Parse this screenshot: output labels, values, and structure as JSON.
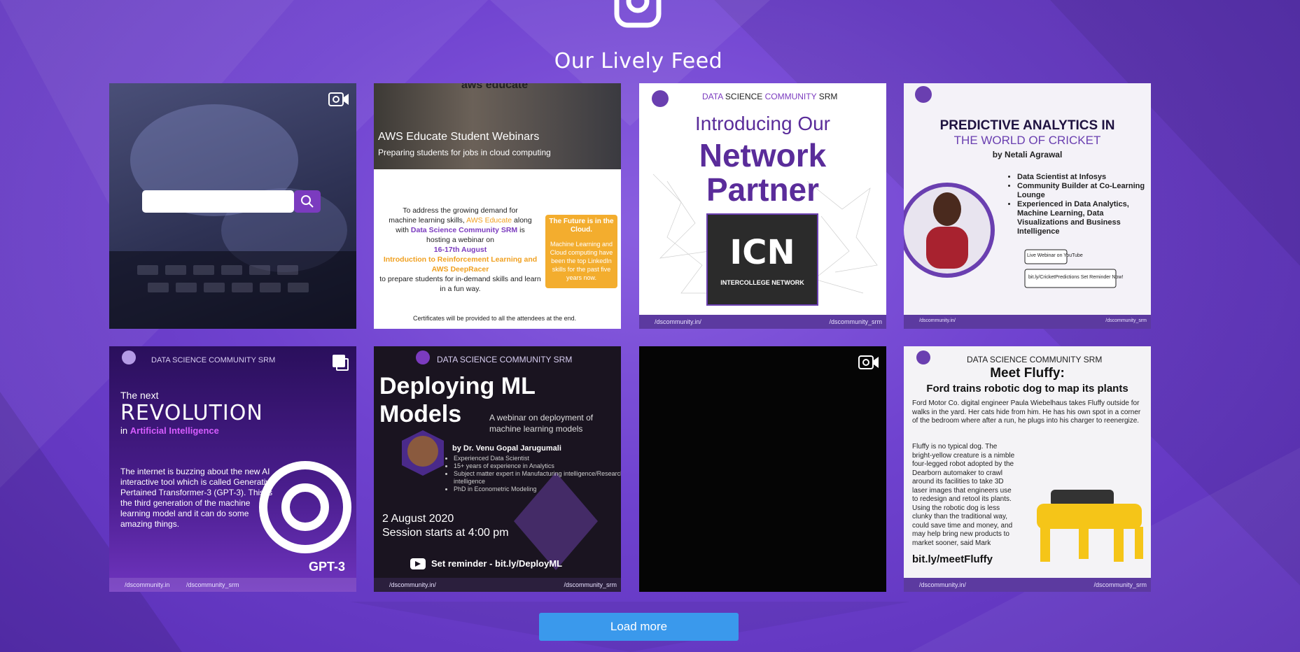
{
  "feed": {
    "title": "Our Lively Feed",
    "load_more_label": "Load more",
    "accent_button": "#3a99ec",
    "tiles": [
      {
        "kind": "video",
        "caption": ""
      },
      {
        "kind": "image",
        "top_logo": "aws educate",
        "heading": "AWS Educate Student Webinars",
        "subheading": "Preparing students for jobs in cloud computing",
        "body_lines": [
          "To address the growing demand for",
          "machine learning skills,",
          "with",
          "is",
          "hosting a webinar on"
        ],
        "highlight_aws": "AWS Educate",
        "along": "along",
        "highlight_dsc": "Data Science Community SRM",
        "date": "16-17th August",
        "topic": "Introduction to Reinforcement Learning and AWS DeepRacer",
        "tail": "to prepare students for in-demand skills and learn in a fun way.",
        "side_title": "The Future is in the Cloud.",
        "side_body": "Machine Learning and Cloud computing have been the top LinkedIn skills for the past five years now.",
        "certificates": "Certificates will be provided to all the attendees at the end."
      },
      {
        "kind": "image",
        "brand_a": "DATA",
        "brand_b": "SCIENCE",
        "brand_c": "COMMUNITY",
        "brand_d": "SRM",
        "line1": "Introducing Our",
        "line2": "Network",
        "line3": "Partner",
        "logo_text": "ICN",
        "logo_sub": "INTERCOLLEGE NETWORK",
        "footer_left": "/dscommunity.in/",
        "footer_right": "/dscommunity_srm"
      },
      {
        "kind": "image",
        "title1": "PREDICTIVE ANALYTICS IN",
        "title2": "THE WORLD OF CRICKET",
        "by": "by Netali Agrawal",
        "bullets": [
          "Data Scientist at Infosys",
          "Community Builder at Co-Learning Lounge",
          "Experienced in Data Analytics, Machine Learning, Data Visualizations and Business Intelligence"
        ],
        "cta1": "Live Webinar on YouTube",
        "cta2": "bit.ly/CricketPredictions Set Reminder Now!",
        "footer_left": "/dscommunity.in/",
        "footer_right": "/dscommunity_srm"
      },
      {
        "kind": "carousel",
        "next": "The next",
        "revolution": "REVOLUTION",
        "in_ai_prefix": "in",
        "in_ai": "Artificial Intelligence",
        "body": "The internet is buzzing about the new AI interactive tool which is called Generative Pertained Transformer-3 (GPT-3). This is the third generation of the machine learning model and it can do some amazing things.",
        "gpt": "GPT-3",
        "footer_left": "/dscommunity.in",
        "footer_right": "/dscommunity_srm"
      },
      {
        "kind": "image",
        "title1": "Deploying ML",
        "title2": "Models",
        "tag1": "A webinar on deployment of",
        "tag2": "machine learning models",
        "by": "by Dr. Venu Gopal Jarugumali",
        "bullets": [
          "Experienced Data Scientist",
          "15+ years of experience in Analytics",
          "Subject matter expert in Manufacturing intelligence/Research intelligence",
          "PhD in Econometric Modeling"
        ],
        "date": "2 August 2020",
        "time": "Session starts at 4:00 pm",
        "cta": "Set reminder - bit.ly/DeployML",
        "footer_left": "/dscommunity.in/",
        "footer_right": "/dscommunity_srm"
      },
      {
        "kind": "video",
        "caption": ""
      },
      {
        "kind": "image",
        "title": "Meet Fluffy:",
        "subtitle": "Ford trains robotic dog to map its plants",
        "p1": "Ford Motor Co. digital engineer Paula Wiebelhaus takes Fluffy outside for walks in the yard. Her cats hide from him. He has his own spot in a corner of the bedroom where after a run, he plugs into his charger to reenergize.",
        "p2": "Fluffy is no typical dog. The bright-yellow creature is a nimble four-legged robot adopted by the Dearborn automaker to crawl around its facilities to take 3D laser images that engineers use to redesign and retool its plants. Using the robotic dog is less clunky than the traditional way, could save time and money, and may help bring new products to market sooner, said Mark Goderis, digital engineering manager at Ford's Advanced Manufacturing Center.",
        "link": "bit.ly/meetFluffy",
        "footer_left": "/dscommunity.in/",
        "footer_right": "/dscommunity_srm"
      }
    ]
  }
}
